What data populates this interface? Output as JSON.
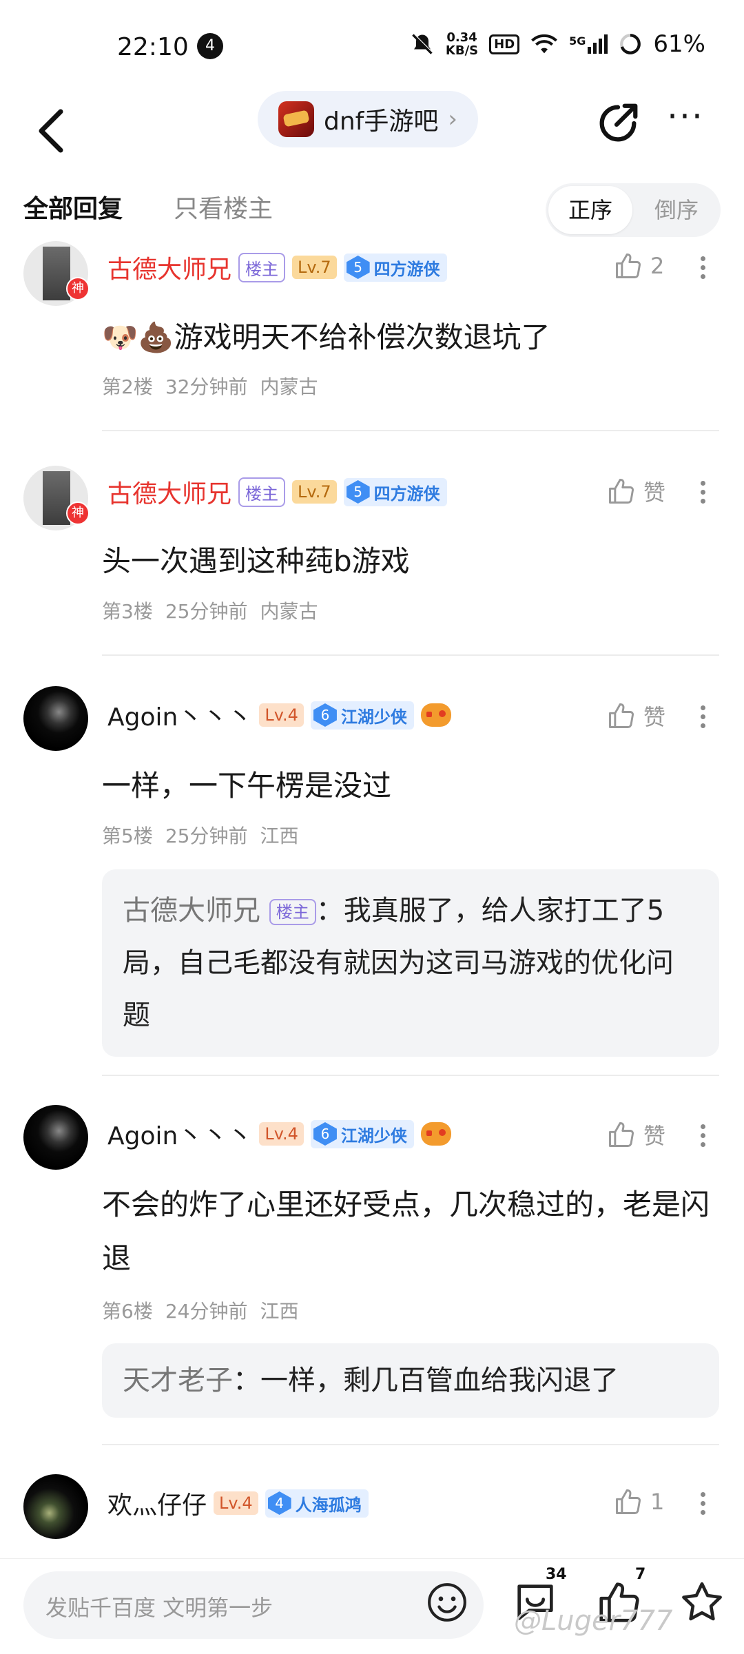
{
  "status_bar": {
    "time": "22:10",
    "notification_count": "4",
    "net_speed_value": "0.34",
    "net_speed_unit": "KB/S",
    "hd_label": "HD",
    "network_type": "5G",
    "battery": "61%"
  },
  "header": {
    "forum_name": "dnf手游吧",
    "chevron": "›"
  },
  "tabs": {
    "all_replies": "全部回复",
    "op_only": "只看楼主",
    "sort_asc": "正序",
    "sort_desc": "倒序"
  },
  "posts": [
    {
      "username": "古德大师兄",
      "op_tag": "楼主",
      "level": "Lv.7",
      "title_level": "5",
      "title_name": "四方游侠",
      "god_badge": "神",
      "likes": "2",
      "content": "🐶💩游戏明天不给补偿次数退坑了",
      "floor": "第2楼",
      "time": "32分钟前",
      "location": "内蒙古"
    },
    {
      "username": "古德大师兄",
      "op_tag": "楼主",
      "level": "Lv.7",
      "title_level": "5",
      "title_name": "四方游侠",
      "god_badge": "神",
      "likes": "赞",
      "content": "头一次遇到这种莼b游戏",
      "floor": "第3楼",
      "time": "25分钟前",
      "location": "内蒙古"
    },
    {
      "username": "Agoin丶丶丶",
      "level": "Lv.4",
      "title_level": "6",
      "title_name": "江湖少侠",
      "likes": "赞",
      "content": "一样，一下午楞是没过",
      "floor": "第5楼",
      "time": "25分钟前",
      "location": "江西",
      "quote": {
        "name": "古德大师兄",
        "op_tag": "楼主",
        "text": "：我真服了，给人家打工了5局，自己毛都没有就因为这司马游戏的优化问题"
      }
    },
    {
      "username": "Agoin丶丶丶",
      "level": "Lv.4",
      "title_level": "6",
      "title_name": "江湖少侠",
      "likes": "赞",
      "content": "不会的炸了心里还好受点，几次稳过的，老是闪退",
      "floor": "第6楼",
      "time": "24分钟前",
      "location": "江西",
      "quote": {
        "name": "天才老子",
        "text": "：一样，剩几百管血给我闪退了"
      }
    },
    {
      "username": "欢灬仔仔",
      "level": "Lv.4",
      "title_level": "4",
      "title_name": "人海孤鸿",
      "likes": "1"
    }
  ],
  "bottom_bar": {
    "input_placeholder": "发贴千百度 文明第一步",
    "comment_count": "34",
    "like_count": "7"
  },
  "watermark": "@Luger777"
}
